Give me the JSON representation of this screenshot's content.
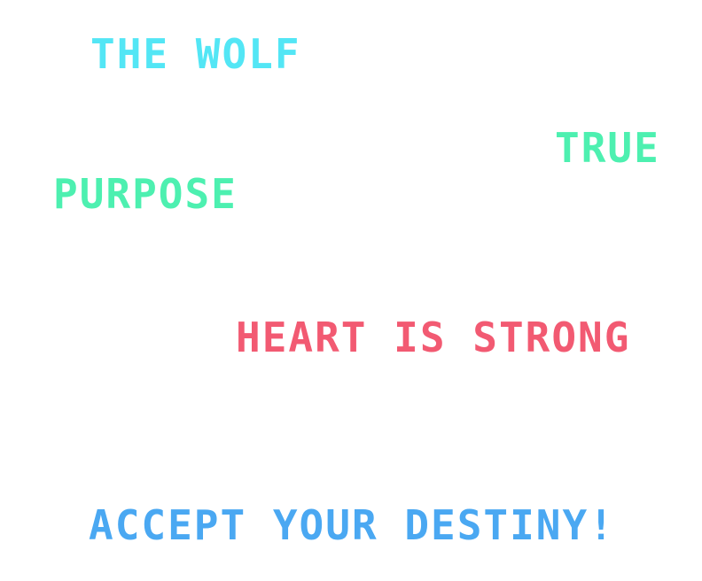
{
  "phrases": {
    "wolf": "THE WOLF",
    "true": "TRUE",
    "purpose": "PURPOSE",
    "heart": "HEART IS STRONG",
    "accept": "ACCEPT YOUR DESTINY!"
  },
  "colors": {
    "cyan": "#53e6f5",
    "mint": "#4df0b0",
    "red": "#f25a72",
    "blue": "#4aa8f2",
    "background": "#ffffff"
  }
}
